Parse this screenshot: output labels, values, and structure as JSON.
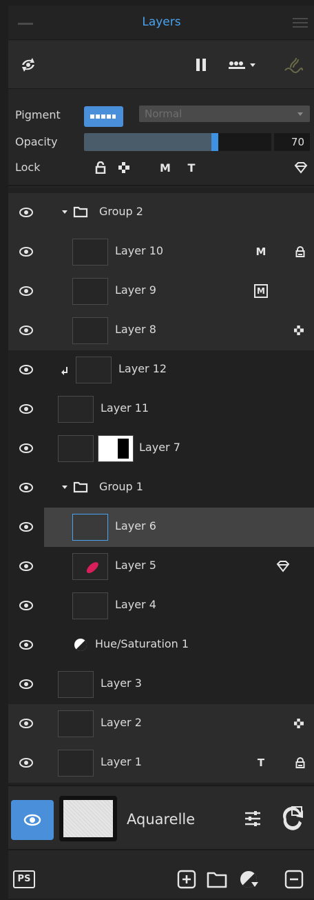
{
  "title": "Layers",
  "properties": {
    "pigment_label": "Pigment",
    "blend_mode": "Normal",
    "opacity_label": "Opacity",
    "opacity_value": "70",
    "opacity_fraction": 0.7,
    "lock_label": "Lock",
    "lock_letter_m": "M",
    "lock_letter_t": "T"
  },
  "layers": [
    {
      "name": "Group 2"
    },
    {
      "name": "Layer 10",
      "badge": "M"
    },
    {
      "name": "Layer 9",
      "badge": "M"
    },
    {
      "name": "Layer 8"
    },
    {
      "name": "Layer 12"
    },
    {
      "name": "Layer 11"
    },
    {
      "name": "Layer 7"
    },
    {
      "name": "Group 1"
    },
    {
      "name": "Layer 6"
    },
    {
      "name": "Layer 5"
    },
    {
      "name": "Layer 4"
    },
    {
      "name": "Hue/Saturation 1"
    },
    {
      "name": "Layer 3"
    },
    {
      "name": "Layer 2"
    },
    {
      "name": "Layer 1",
      "badge": "T"
    }
  ],
  "brush": {
    "name": "Aquarelle"
  },
  "bottom": {
    "ps_label": "PS"
  },
  "colors": {
    "accent": "#4a8fd9",
    "title": "#4aa3f0",
    "panel": "#262626"
  }
}
